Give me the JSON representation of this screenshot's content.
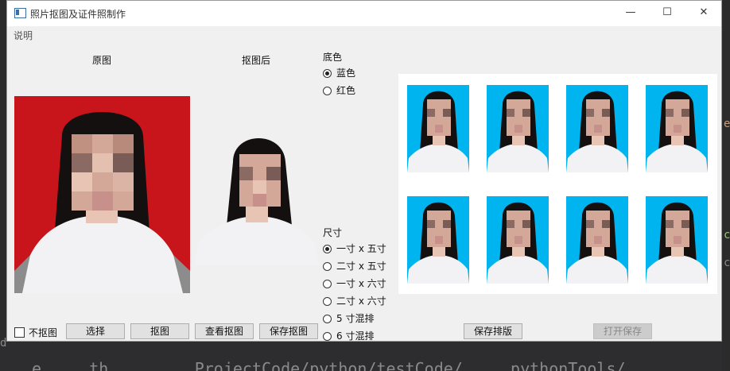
{
  "window": {
    "title": "照片抠图及证件照制作",
    "controls": {
      "minimize": "—",
      "maximize": "☐",
      "close": "✕"
    }
  },
  "menu": {
    "items": [
      "说明"
    ]
  },
  "labels": {
    "original": "原图",
    "cutout": "抠图后"
  },
  "background_color": {
    "title": "底色",
    "options": [
      {
        "label": "蓝色",
        "selected": true
      },
      {
        "label": "红色",
        "selected": false
      }
    ]
  },
  "size": {
    "title": "尺寸",
    "options": [
      {
        "label": "一寸 x 五寸",
        "selected": true
      },
      {
        "label": "二寸 x 五寸",
        "selected": false
      },
      {
        "label": "一寸 x 六寸",
        "selected": false
      },
      {
        "label": "二寸 x 六寸",
        "selected": false
      },
      {
        "label": "5 寸混排",
        "selected": false
      },
      {
        "label": "6 寸混排",
        "selected": false
      }
    ]
  },
  "checkbox": {
    "label": "不抠图",
    "checked": false
  },
  "buttons": {
    "select": "选择",
    "cutout": "抠图",
    "view_cutout": "查看抠图",
    "save_cutout": "保存抠图",
    "save_layout": "保存排版",
    "open_save": "打开保存"
  },
  "colors": {
    "blue_bg": "#00b4f0",
    "red_bg": "#c8141b",
    "window_bg": "#f0f0f0"
  },
  "background_code": {
    "text": "e  ... th ... ... ProjectCode/python/testCode/ ... pythonTools/... "
  }
}
